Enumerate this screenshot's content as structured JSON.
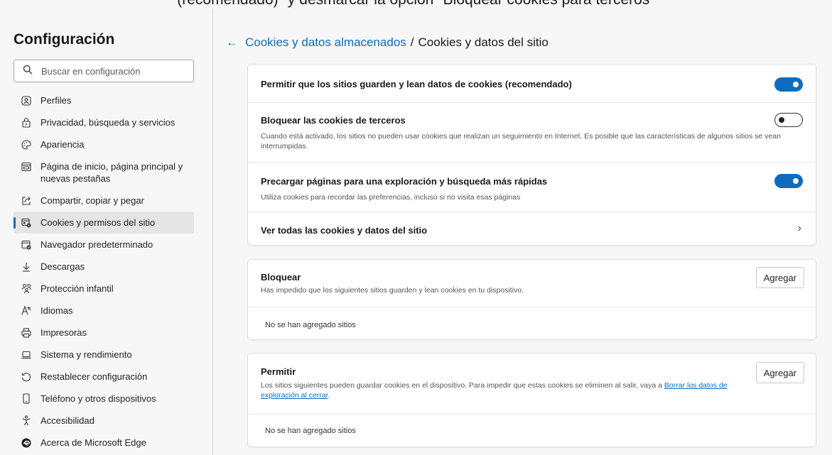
{
  "caption": "(recomendado)\" y desmarcar la opción \"Bloquear cookies para terceros\"",
  "sidebar": {
    "title": "Configuración",
    "search_placeholder": "Buscar en configuración",
    "items": [
      {
        "label": "Perfiles",
        "icon": "profile-icon"
      },
      {
        "label": "Privacidad, búsqueda y servicios",
        "icon": "lock-icon"
      },
      {
        "label": "Apariencia",
        "icon": "appearance-icon"
      },
      {
        "label": "Página de inicio, página principal y nuevas pestañas",
        "icon": "home-tab-icon"
      },
      {
        "label": "Compartir, copiar y pegar",
        "icon": "share-icon"
      },
      {
        "label": "Cookies y permisos del sitio",
        "icon": "cookies-icon",
        "active": true
      },
      {
        "label": "Navegador predeterminado",
        "icon": "default-browser-icon"
      },
      {
        "label": "Descargas",
        "icon": "download-icon"
      },
      {
        "label": "Protección infantil",
        "icon": "family-icon"
      },
      {
        "label": "Idiomas",
        "icon": "language-icon"
      },
      {
        "label": "Impresoras",
        "icon": "printer-icon"
      },
      {
        "label": "Sistema y rendimiento",
        "icon": "laptop-icon"
      },
      {
        "label": "Restablecer configuración",
        "icon": "reset-icon"
      },
      {
        "label": "Teléfono y otros dispositivos",
        "icon": "phone-icon"
      },
      {
        "label": "Accesibilidad",
        "icon": "accessibility-icon"
      },
      {
        "label": "Acerca de Microsoft Edge",
        "icon": "edge-logo-icon"
      }
    ]
  },
  "breadcrumb": {
    "parent": "Cookies y datos almacenados",
    "separator": "/",
    "current": "Cookies y datos del sitio"
  },
  "settings": {
    "allow_cookies": {
      "title": "Permitir que los sitios guarden y lean datos de cookies (recomendado)",
      "enabled": true
    },
    "block_third_party": {
      "title": "Bloquear las cookies de terceros",
      "desc": "Cuando está activado, los sitios no pueden usar cookies que realizan un seguimiento en Internet. Es posible que las características de algunos sitios se vean interrumpidas.",
      "enabled": false
    },
    "preload": {
      "title": "Precargar páginas para una exploración y búsqueda más rápidas",
      "desc": "Utiliza cookies para recordar las preferencias, incluso si no visita esas páginas",
      "enabled": true
    },
    "see_all": {
      "title": "Ver todas las cookies y datos del sitio"
    }
  },
  "block": {
    "title": "Bloquear",
    "desc": "Has impedido que los siguientes sitios guarden y lean cookies en tu dispositivo.",
    "add_label": "Agregar",
    "empty": "No se han agregado sitios"
  },
  "allow": {
    "title": "Permitir",
    "desc_before": "Los sitios siguientes pueden guardar cookies en el dispositivo. Para impedir que estas cookies se eliminen al salir, vaya a ",
    "desc_link": "Borrar los datos de exploración al cerrar",
    "desc_after": ".",
    "add_label": "Agregar",
    "empty": "No se han agregado sitios"
  },
  "colors": {
    "accent": "#0f6cbd",
    "background": "#f7f7f7",
    "card": "#ffffff"
  }
}
